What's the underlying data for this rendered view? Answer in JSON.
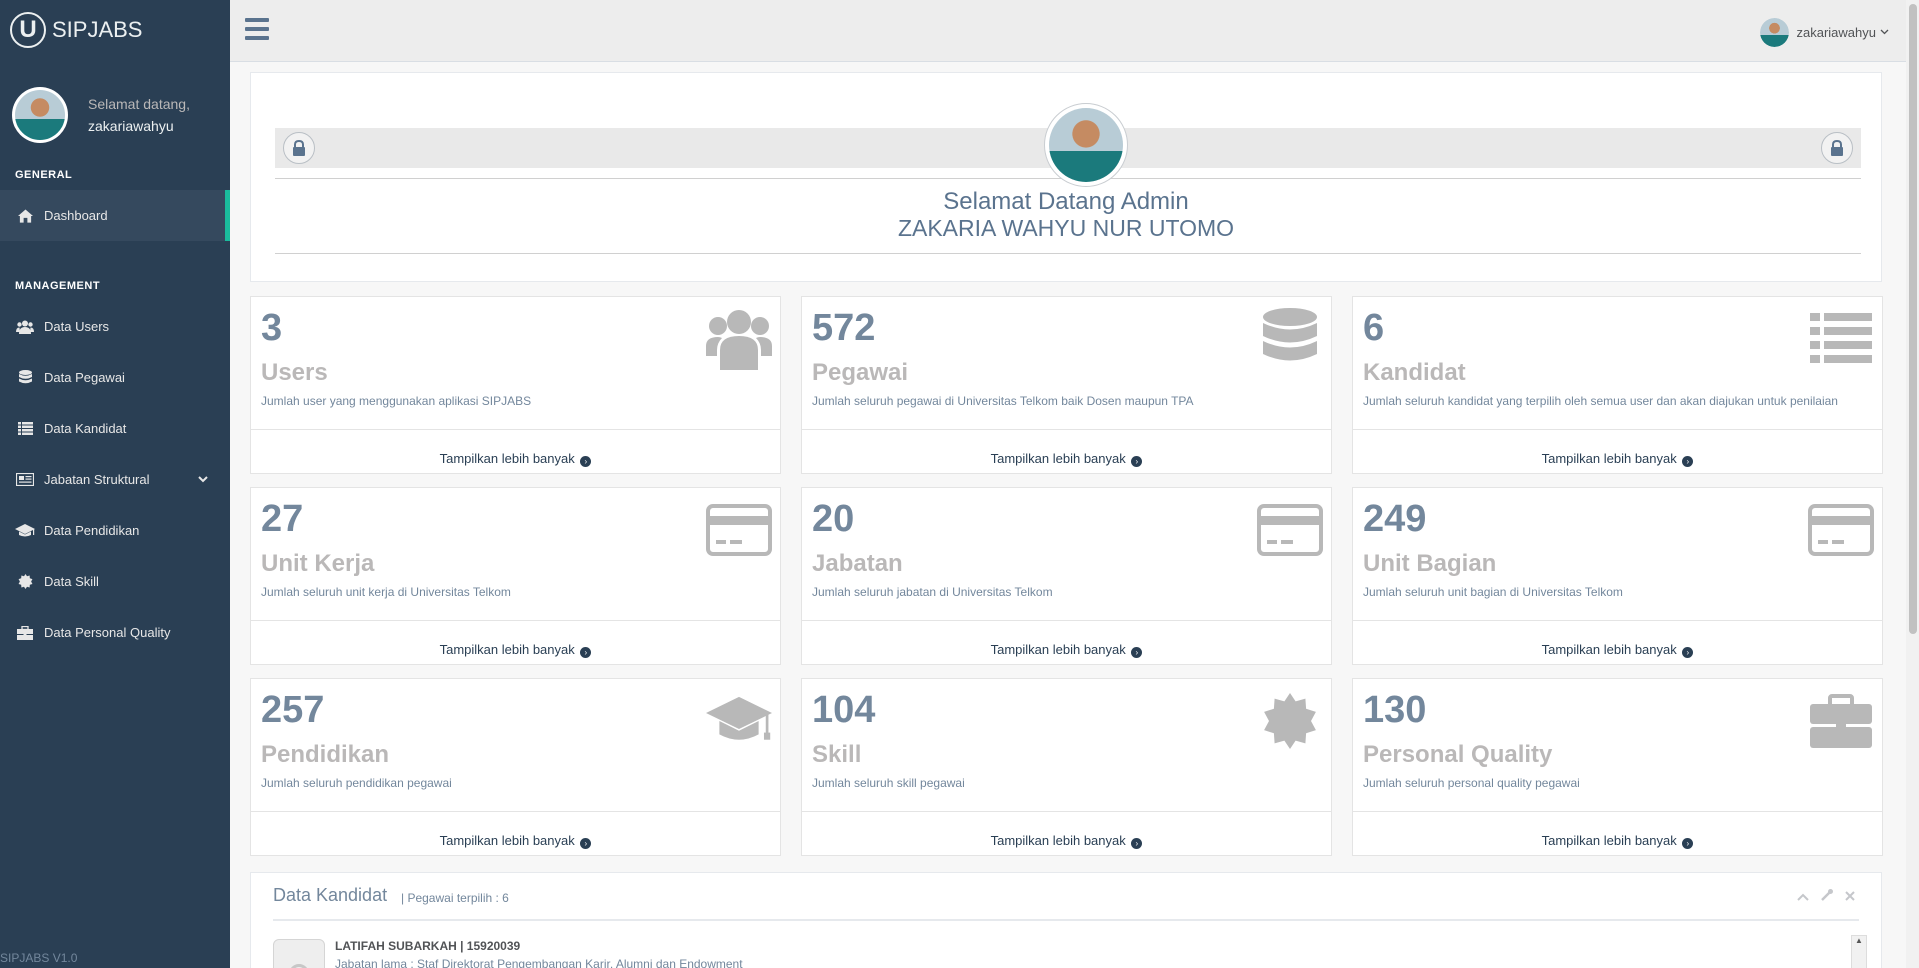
{
  "app": {
    "brand_letter": "U",
    "brand_name": "SIPJABS",
    "version": "SIPJABS V1.0"
  },
  "sidebar": {
    "welcome": "Selamat datang,",
    "username": "zakariawahyu",
    "sections": {
      "general": "GENERAL",
      "management": "MANAGEMENT"
    },
    "items": [
      {
        "label": "Dashboard",
        "icon": "home-icon"
      },
      {
        "label": "Data Users",
        "icon": "users-icon"
      },
      {
        "label": "Data Pegawai",
        "icon": "database-icon"
      },
      {
        "label": "Data Kandidat",
        "icon": "list-icon"
      },
      {
        "label": "Jabatan Struktural",
        "icon": "newspaper-icon"
      },
      {
        "label": "Data Pendidikan",
        "icon": "graduation-cap-icon"
      },
      {
        "label": "Data Skill",
        "icon": "certificate-icon"
      },
      {
        "label": "Data Personal Quality",
        "icon": "briefcase-icon"
      }
    ]
  },
  "topbar": {
    "username": "zakariawahyu"
  },
  "welcome": {
    "title": "Selamat Datang Admin",
    "name": "ZAKARIA WAHYU NUR UTOMO"
  },
  "more_label": "Tampilkan lebih banyak",
  "tiles": [
    {
      "count": "3",
      "label": "Users",
      "desc": "Jumlah user yang menggunakan aplikasi SIPJABS",
      "icon": "users-icon"
    },
    {
      "count": "572",
      "label": "Pegawai",
      "desc": "Jumlah seluruh pegawai di Universitas Telkom baik Dosen maupun TPA",
      "icon": "database-icon"
    },
    {
      "count": "6",
      "label": "Kandidat",
      "desc": "Jumlah seluruh kandidat yang terpilih oleh semua user dan akan diajukan untuk penilaian",
      "icon": "list-icon"
    },
    {
      "count": "27",
      "label": "Unit Kerja",
      "desc": "Jumlah seluruh unit kerja di Universitas Telkom",
      "icon": "credit-card-icon"
    },
    {
      "count": "20",
      "label": "Jabatan",
      "desc": "Jumlah seluruh jabatan di Universitas Telkom",
      "icon": "credit-card-icon"
    },
    {
      "count": "249",
      "label": "Unit Bagian",
      "desc": "Jumlah seluruh unit bagian di Universitas Telkom",
      "icon": "credit-card-icon"
    },
    {
      "count": "257",
      "label": "Pendidikan",
      "desc": "Jumlah seluruh pendidikan pegawai",
      "icon": "graduation-cap-icon"
    },
    {
      "count": "104",
      "label": "Skill",
      "desc": "Jumlah seluruh skill pegawai",
      "icon": "certificate-icon"
    },
    {
      "count": "130",
      "label": "Personal Quality",
      "desc": "Jumlah seluruh personal quality pegawai",
      "icon": "briefcase-icon"
    }
  ],
  "kandidat": {
    "title": "Data Kandidat",
    "subtitle": "| Pegawai terpilih : 6",
    "items": [
      {
        "name": "LATIFAH SUBARKAH | 15920039",
        "job": "Jabatan lama : Staf Direktorat Pengembangan Karir, Alumni dan Endowment"
      }
    ]
  },
  "colors": {
    "sidebar_bg": "#2a3f54",
    "accent": "#1abb9c",
    "text": "#73879c"
  }
}
